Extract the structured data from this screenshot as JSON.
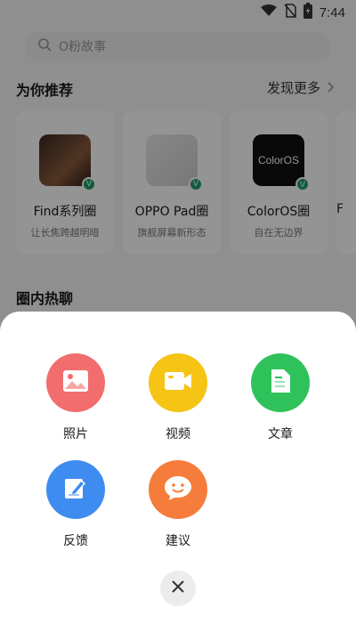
{
  "status_bar": {
    "time": "7:44"
  },
  "search": {
    "placeholder": "O粉故事"
  },
  "recommend": {
    "title": "为你推荐",
    "more_label": "发现更多",
    "cards": [
      {
        "name": "Find系列圈",
        "desc": "让长焦跨越明暗"
      },
      {
        "name": "OPPO Pad圈",
        "desc": "旗舰屏幕新形态"
      },
      {
        "name": "ColorOS圈",
        "desc": "自在无边界",
        "thumb_text": "ColorOS"
      },
      {
        "name": "F"
      }
    ]
  },
  "hot_chat": {
    "title": "圈内热聊"
  },
  "sheet": {
    "actions": [
      {
        "label": "照片",
        "icon": "image-icon",
        "color": "#f26d6d"
      },
      {
        "label": "视频",
        "icon": "video-icon",
        "color": "#f5c414"
      },
      {
        "label": "文章",
        "icon": "article-icon",
        "color": "#2fc25b"
      },
      {
        "label": "反馈",
        "icon": "edit-icon",
        "color": "#3f8cf0"
      },
      {
        "label": "建议",
        "icon": "smile-chat-icon",
        "color": "#f57c3b"
      }
    ],
    "close_icon": "close-icon"
  }
}
